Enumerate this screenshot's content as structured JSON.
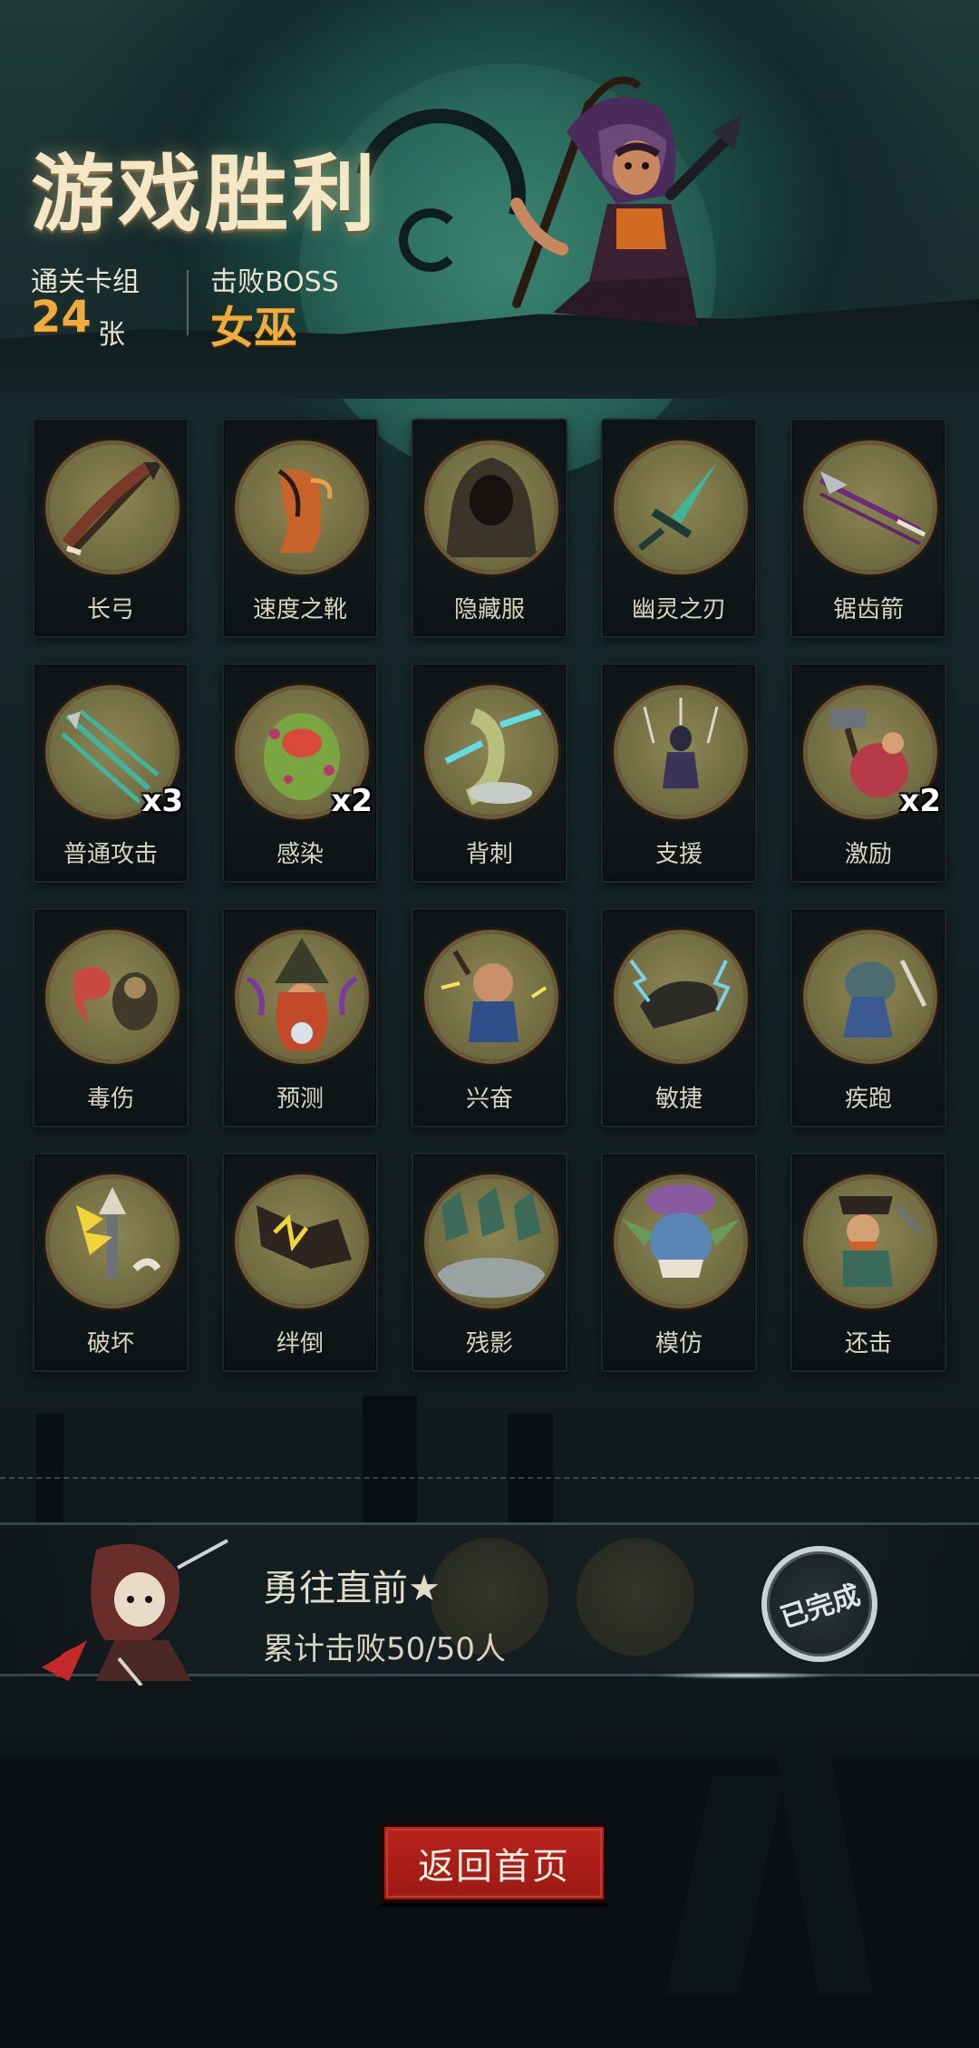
{
  "header": {
    "title": "游戏胜利",
    "deck_label": "通关卡组",
    "deck_count": "24",
    "deck_unit": "张",
    "boss_label": "击败BOSS",
    "boss_name": "女巫"
  },
  "cards": [
    {
      "label": "长弓",
      "icon": "longbow-icon",
      "multiplier": ""
    },
    {
      "label": "速度之靴",
      "icon": "speed-boots-icon",
      "multiplier": ""
    },
    {
      "label": "隐藏服",
      "icon": "hooded-cloak-icon",
      "multiplier": ""
    },
    {
      "label": "幽灵之刃",
      "icon": "ghost-blade-icon",
      "multiplier": ""
    },
    {
      "label": "锯齿箭",
      "icon": "serrated-arrow-icon",
      "multiplier": ""
    },
    {
      "label": "普通攻击",
      "icon": "arrows-attack-icon",
      "multiplier": "x3"
    },
    {
      "label": "感染",
      "icon": "infected-monster-icon",
      "multiplier": "x2"
    },
    {
      "label": "背刺",
      "icon": "backstab-icon",
      "multiplier": ""
    },
    {
      "label": "支援",
      "icon": "support-icon",
      "multiplier": ""
    },
    {
      "label": "激励",
      "icon": "hammer-warrior-icon",
      "multiplier": "x2"
    },
    {
      "label": "毒伤",
      "icon": "poison-octopus-icon",
      "multiplier": ""
    },
    {
      "label": "预测",
      "icon": "witch-crystal-ball-icon",
      "multiplier": ""
    },
    {
      "label": "兴奋",
      "icon": "excited-dwarf-icon",
      "multiplier": ""
    },
    {
      "label": "敏捷",
      "icon": "lightning-panther-icon",
      "multiplier": ""
    },
    {
      "label": "疾跑",
      "icon": "running-beast-icon",
      "multiplier": ""
    },
    {
      "label": "破坏",
      "icon": "break-sword-icon",
      "multiplier": ""
    },
    {
      "label": "绊倒",
      "icon": "trip-boot-icon",
      "multiplier": ""
    },
    {
      "label": "残影",
      "icon": "afterimage-cloaks-icon",
      "multiplier": ""
    },
    {
      "label": "模仿",
      "icon": "masked-troll-icon",
      "multiplier": ""
    },
    {
      "label": "还击",
      "icon": "counter-pirate-icon",
      "multiplier": ""
    }
  ],
  "achievement": {
    "title": "勇往直前★",
    "progress": "累计击败50/50人",
    "status": "已完成"
  },
  "footer": {
    "home_button": "返回首页"
  },
  "colors": {
    "accent_gold": "#f0ac3a",
    "button_red": "#b8231c",
    "badge_bg": "#8c8554"
  }
}
